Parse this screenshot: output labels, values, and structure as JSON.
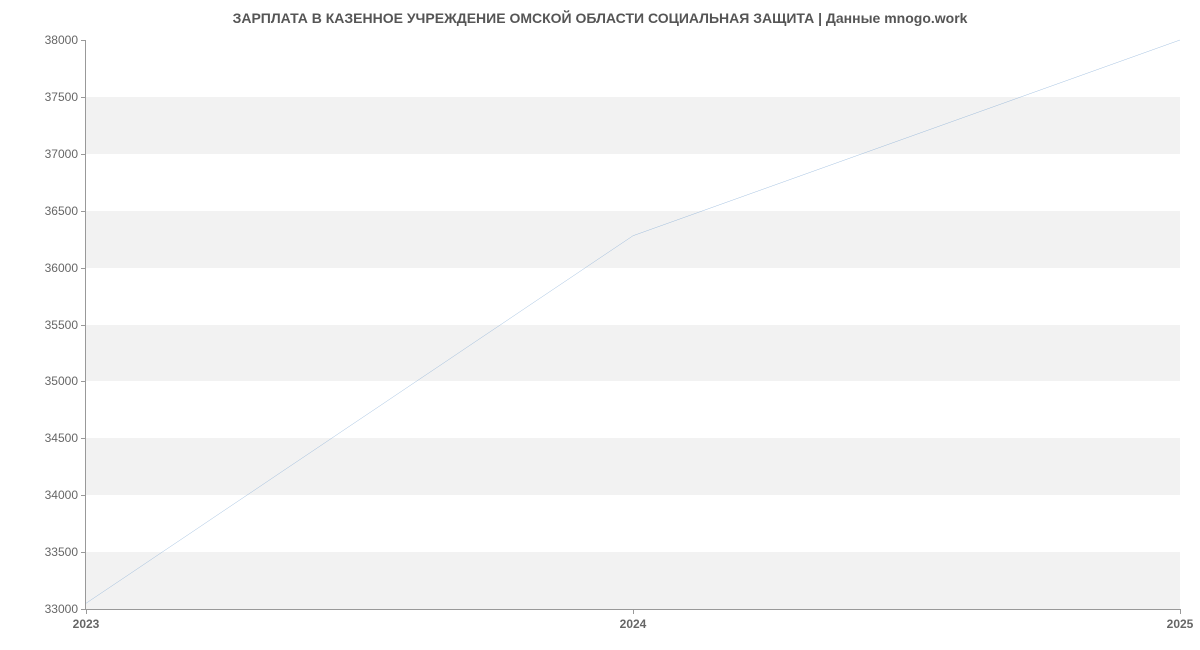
{
  "chart_data": {
    "type": "line",
    "title": "ЗАРПЛАТА В КАЗЕННОЕ УЧРЕЖДЕНИЕ ОМСКОЙ ОБЛАСТИ СОЦИАЛЬНАЯ ЗАЩИТА | Данные mnogo.work",
    "x": [
      2023,
      2024,
      2025
    ],
    "values": [
      33050,
      36280,
      38000
    ],
    "xlabel": "",
    "ylabel": "",
    "xlim": [
      2023,
      2025
    ],
    "ylim": [
      33000,
      38000
    ],
    "x_ticks": [
      2023,
      2024,
      2025
    ],
    "y_ticks": [
      33000,
      33500,
      34000,
      34500,
      35000,
      35500,
      36000,
      36500,
      37000,
      37500,
      38000
    ],
    "line_color": "#6699cc"
  }
}
